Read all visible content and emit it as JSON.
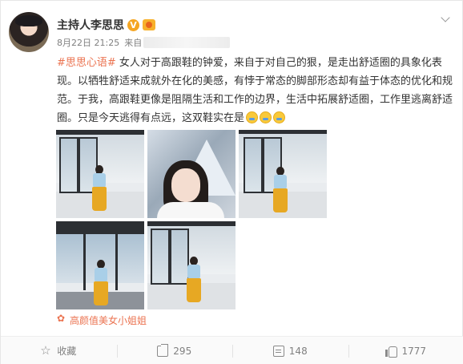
{
  "post": {
    "author": "主持人李思思",
    "verified_badge": "V",
    "date": "8月22日 21:25",
    "from_label": "来自",
    "hashtag": "#思思心语#",
    "body": " 女人对于高跟鞋的钟爱，来自于对自己的狠，是走出舒适圈的具象化表现。以牺牲舒适来成就外在化的美感，有悖于常态的脚部形态却有益于体态的优化和规范。于我，高跟鞋更像是阻隔生活和工作的边界，生活中拓展舒适圈，工作里逃离舒适圈。只是今天逃得有点远，这双鞋实在是",
    "emojis": [
      "crying-laughing-icon",
      "crying-laughing-icon",
      "crying-laughing-icon"
    ],
    "source": "高颜值美女小姐姐"
  },
  "actions": {
    "favorite_label": "收藏",
    "repost_count": "295",
    "comment_count": "148",
    "like_count": "1777"
  },
  "colors": {
    "accent": "#eb7350",
    "text": "#333333",
    "meta": "#808080",
    "skirt_yellow": "#e7a823",
    "vip_gold": "#f5a623"
  }
}
